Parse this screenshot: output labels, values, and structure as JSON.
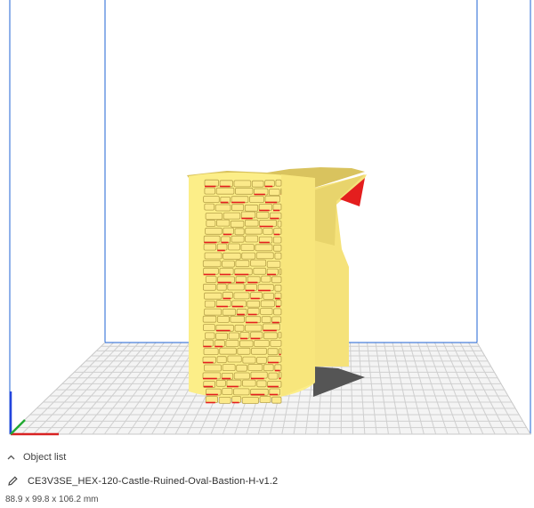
{
  "viewport": {
    "axis_colors": {
      "x": "#d82222",
      "y": "#2244dd",
      "z": "#22aa33"
    },
    "model_color": "#fcee88",
    "overhang_color": "#e41e1e",
    "buildplate_color": "#d6d6d6",
    "volume_edge_color": "#1f63d6"
  },
  "object_list": {
    "toggle_icon": "chevron-up-icon",
    "label": "Object list"
  },
  "selected_object": {
    "edit_icon": "pencil-icon",
    "name": "CE3V3SE_HEX-120-Castle-Ruined-Oval-Bastion-H-v1.2",
    "dimensions": "88.9 x 99.8 x 106.2 mm"
  }
}
